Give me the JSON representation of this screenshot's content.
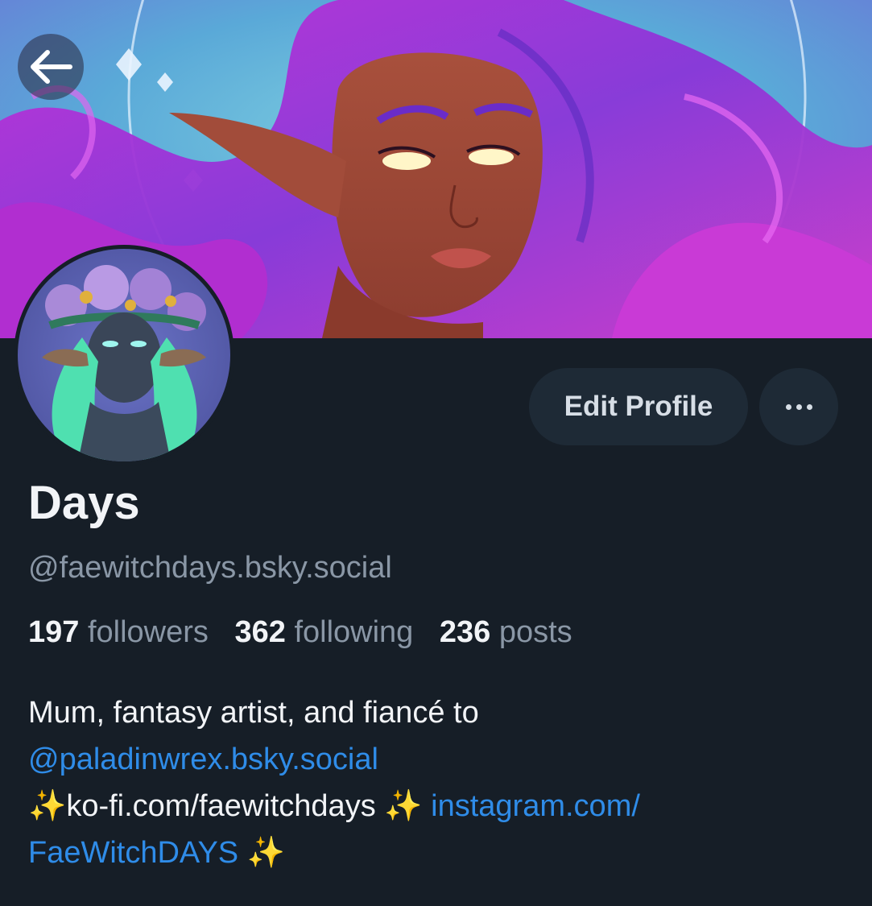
{
  "profile": {
    "display_name": "Days",
    "handle": "@faewitchdays.bsky.social",
    "avatar_label": "profile avatar",
    "banner_label": "profile banner"
  },
  "actions": {
    "back_icon": "arrow-left-icon",
    "edit_profile_label": "Edit Profile",
    "more_icon": "ellipsis-icon"
  },
  "stats": [
    {
      "count": "197",
      "label": "followers"
    },
    {
      "count": "362",
      "label": "following"
    },
    {
      "count": "236",
      "label": "posts"
    }
  ],
  "bio": {
    "line1": "Mum, fantasy artist, and fiancé to",
    "mention": "@paladinwrex.bsky.social",
    "sparkle": "✨",
    "kofi": "ko-fi.com/faewitchdays",
    "instagram_part1": "instagram.com/",
    "instagram_part2": "FaeWitchDAYS"
  },
  "colors": {
    "background": "#161e27",
    "button": "#1e2a36",
    "link": "#2f8ce8",
    "muted_text": "#8a97a6",
    "text": "#f2f4f7"
  }
}
